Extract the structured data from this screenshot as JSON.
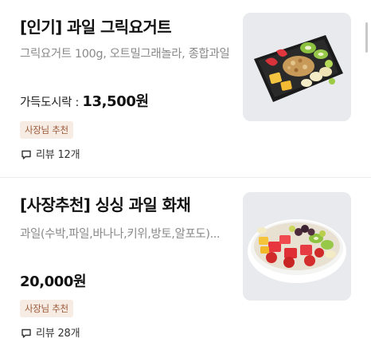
{
  "menu": {
    "items": [
      {
        "title": "[인기] 과일 그릭요거트",
        "description": "그릭요거트 100g, 오트밀그래놀라, 종합과일",
        "price_prefix": "가득도시락 : ",
        "price": "13,500원",
        "badge": "사장님 추천",
        "review_label": "리뷰 12개",
        "image_icon": "greek-yogurt-bowl-image"
      },
      {
        "title": "[사장추천] 싱싱 과일 화채",
        "description": "과일(수박,파일,바나나,키위,방토,알포도)...",
        "price": "20,000원",
        "badge": "사장님 추천",
        "review_label": "리뷰 28개",
        "image_icon": "fruit-punch-bowl-image"
      }
    ]
  },
  "colors": {
    "badge_bg": "#f7ece4",
    "badge_text": "#9a5a3a",
    "description_text": "#8a8a8a",
    "thumb_bg": "#e9eaee"
  },
  "icons": {
    "review": "comment-icon"
  }
}
